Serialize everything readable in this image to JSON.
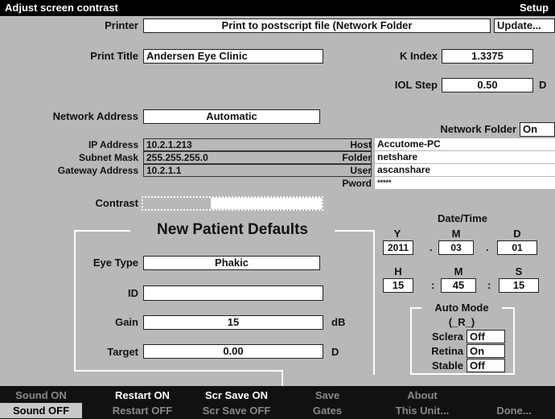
{
  "window": {
    "title": "Adjust screen contrast",
    "tab": "Setup"
  },
  "printer": {
    "label": "Printer",
    "value": "Print to postscript file (Network Folder",
    "update_button": "Update..."
  },
  "print_title": {
    "label": "Print Title",
    "value": "Andersen Eye Clinic"
  },
  "k_index": {
    "label": "K Index",
    "value": "1.3375"
  },
  "iol_step": {
    "label": "IOL Step",
    "value": "0.50",
    "unit": "D"
  },
  "network_address": {
    "label": "Network Address",
    "value": "Automatic"
  },
  "network": {
    "ip_label": "IP Address",
    "ip_value": "10.2.1.213",
    "mask_label": "Subnet Mask",
    "mask_value": "255.255.255.0",
    "gateway_label": "Gateway Address",
    "gateway_value": "10.2.1.1"
  },
  "network_folder": {
    "label": "Network Folder",
    "toggle": "On",
    "host_label": "Host",
    "host_value": "Accutome-PC",
    "folder_label": "Folder",
    "folder_value": "netshare",
    "user_label": "User",
    "user_value": "ascanshare",
    "pword_label": "Pword",
    "pword_value": "*****"
  },
  "contrast": {
    "label": "Contrast",
    "level": 0.38
  },
  "defaults": {
    "title": "New Patient Defaults",
    "eye_type_label": "Eye Type",
    "eye_type_value": "Phakic",
    "id_label": "ID",
    "id_value": "",
    "gain_label": "Gain",
    "gain_value": "15",
    "gain_unit": "dB",
    "target_label": "Target",
    "target_value": "0.00",
    "target_unit": "D"
  },
  "datetime": {
    "title": "Date/Time",
    "y_label": "Y",
    "m_label": "M",
    "d_label": "D",
    "year": "2011",
    "month": "03",
    "day": "01",
    "date_sep": ".",
    "h_label": "H",
    "min_label": "M",
    "s_label": "S",
    "hour": "15",
    "minute": "45",
    "second": "15",
    "time_sep": ":"
  },
  "auto_mode": {
    "title": "Auto Mode",
    "current": "(_R_)",
    "sclera_label": "Sclera",
    "sclera_value": "Off",
    "retina_label": "Retina",
    "retina_value": "On",
    "stable_label": "Stable",
    "stable_value": "Off"
  },
  "softkeys": {
    "sound_on": "Sound ON",
    "sound_off": "Sound OFF",
    "restart_on": "Restart ON",
    "restart_off": "Restart OFF",
    "scrsave_on": "Scr Save ON",
    "scrsave_off": "Scr Save OFF",
    "save": "Save",
    "gates": "Gates",
    "about": "About",
    "this_unit": "This Unit...",
    "done": "Done..."
  }
}
